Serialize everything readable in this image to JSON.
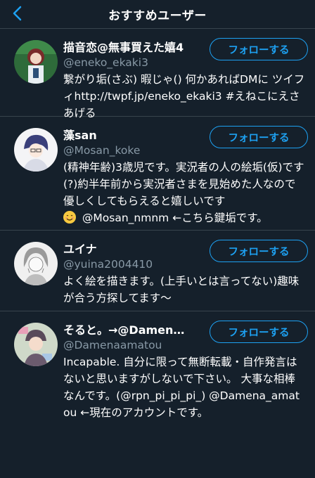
{
  "header": {
    "title": "おすすめユーザー",
    "back_icon": "chevron-left-icon"
  },
  "colors": {
    "background": "#15202b",
    "accent": "#1da1f2",
    "secondary_text": "#8899a6",
    "divider": "#38444d"
  },
  "users": [
    {
      "name": "描音恋@無事買えた嬉4",
      "handle": "@eneko_ekaki3",
      "bio": "繋がり垢(さぶ) 暇じゃ() 何かあればDMに ツイフィhttp://twpf.jp/eneko_ekaki3 #えねこにえさあげる",
      "follow_label": "フォローする"
    },
    {
      "name": "藻san",
      "handle": "@Mosan_koke",
      "bio_prefix": "(精神年齢)3歳児です。実況者の人の絵垢(仮)です(?)約半年前から実況者さまを見始めた人なので優しくしてもらえると嬉しいです",
      "bio_emoji": "smiling-face-icon",
      "bio_suffix": " @Mosan_nmnm ←こちら鍵垢です。",
      "follow_label": "フォローする"
    },
    {
      "name": "ユイナ",
      "handle": "@yuina2004410",
      "bio": "よく絵を描きます。(上手いとは言ってない)趣味が合う方探してます〜",
      "follow_label": "フォローする"
    },
    {
      "name": "そると。→@Damenaamatou",
      "handle": "@Damenaamatou",
      "bio": "Incapable. 自分に限って無断転載・自作発言はないと思いますがしないで下さい。 大事な相棒なんです。(@rpn_pi_pi_pi_) @Damena_amatou ←現在のアカウントです。",
      "follow_label": "フォローする"
    }
  ]
}
